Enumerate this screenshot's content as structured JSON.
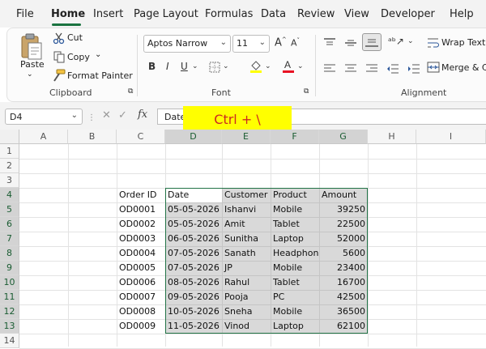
{
  "menu": {
    "items": [
      "File",
      "Home",
      "Insert",
      "Page Layout",
      "Formulas",
      "Data",
      "Review",
      "View",
      "Developer",
      "Help"
    ]
  },
  "ribbon": {
    "clipboard": {
      "paste_label": "Paste",
      "cut_label": "Cut",
      "copy_label": "Copy",
      "format_painter_label": "Format Painter",
      "group_label": "Clipboard"
    },
    "font": {
      "font_name": "Aptos Narrow",
      "font_size": "11",
      "group_label": "Font",
      "highlight_color": "#ffff00",
      "font_color": "#e81123"
    },
    "alignment": {
      "wrap_text_label": "Wrap Text",
      "merge_label": "Merge & C",
      "group_label": "Alignment"
    }
  },
  "formula_bar": {
    "name_box": "D4",
    "formula_value": "Date",
    "fx_label": "fx"
  },
  "overlay": {
    "shortcut": "Ctrl + \\"
  },
  "grid": {
    "columns": [
      "A",
      "B",
      "C",
      "D",
      "E",
      "F",
      "G",
      "H",
      "I"
    ],
    "rows": [
      "1",
      "2",
      "3",
      "4",
      "5",
      "6",
      "7",
      "8",
      "9",
      "10",
      "11",
      "12",
      "13",
      "14"
    ],
    "headers": {
      "order_id": "Order ID",
      "date": "Date",
      "customer": "Customer",
      "product": "Product",
      "amount": "Amount"
    },
    "records": [
      {
        "order_id": "OD0001",
        "date": "05-05-2026",
        "customer": "Ishanvi",
        "product": "Mobile",
        "amount": "39250"
      },
      {
        "order_id": "OD0002",
        "date": "05-05-2026",
        "customer": "Amit",
        "product": "Tablet",
        "amount": "22500"
      },
      {
        "order_id": "OD0003",
        "date": "06-05-2026",
        "customer": "Sunitha",
        "product": "Laptop",
        "amount": "52000"
      },
      {
        "order_id": "OD0004",
        "date": "07-05-2026",
        "customer": "Sanath",
        "product": "Headphon",
        "amount": "5600"
      },
      {
        "order_id": "OD0005",
        "date": "07-05-2026",
        "customer": "JP",
        "product": "Mobile",
        "amount": "23400"
      },
      {
        "order_id": "OD0006",
        "date": "08-05-2026",
        "customer": "Rahul",
        "product": "Tablet",
        "amount": "16700"
      },
      {
        "order_id": "OD0007",
        "date": "09-05-2026",
        "customer": "Pooja",
        "product": "PC",
        "amount": "42500"
      },
      {
        "order_id": "OD0008",
        "date": "10-05-2026",
        "customer": "Sneha",
        "product": "Mobile",
        "amount": "36500"
      },
      {
        "order_id": "OD0009",
        "date": "11-05-2026",
        "customer": "Vinod",
        "product": "Laptop",
        "amount": "62100"
      }
    ]
  }
}
